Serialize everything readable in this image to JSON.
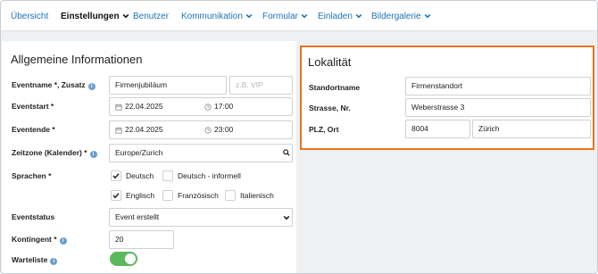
{
  "nav": {
    "items": [
      {
        "label": "Übersicht",
        "dropdown": false,
        "active": false
      },
      {
        "label": "Einstellungen",
        "dropdown": true,
        "active": true
      },
      {
        "label": "Benutzer",
        "dropdown": false,
        "active": false
      },
      {
        "label": "Kommunikation",
        "dropdown": true,
        "active": false
      },
      {
        "label": "Formular",
        "dropdown": true,
        "active": false
      },
      {
        "label": "Einladen",
        "dropdown": true,
        "active": false
      },
      {
        "label": "Bildergalerie",
        "dropdown": true,
        "active": false
      }
    ]
  },
  "general": {
    "title": "Allgemeine Informationen",
    "eventname_label": "Eventname *, Zusatz",
    "eventname_value": "Firmenjubiläum",
    "zusatz_placeholder": "z.B. VIP",
    "start_label": "Eventstart *",
    "start_date": "22.04.2025",
    "start_time": "17:00",
    "end_label": "Eventende *",
    "end_date": "22.04.2025",
    "end_time": "23:00",
    "timezone_label": "Zeitzone (Kalender) *",
    "timezone_value": "Europe/Zurich",
    "languages_label": "Sprachen *",
    "languages": [
      {
        "label": "Deutsch",
        "checked": true
      },
      {
        "label": "Deutsch - informell",
        "checked": false
      },
      {
        "label": "Englisch",
        "checked": true
      },
      {
        "label": "Französisch",
        "checked": false
      },
      {
        "label": "Italienisch",
        "checked": false
      }
    ],
    "status_label": "Eventstatus",
    "status_value": "Event erstellt",
    "quota_label": "Kontingent *",
    "quota_value": "20",
    "waitlist_label": "Warteliste",
    "waitlist_on": true
  },
  "location": {
    "title": "Lokalität",
    "site_label": "Standortname",
    "site_value": "Firmenstandort",
    "street_label": "Strasse, Nr.",
    "street_value": "Weberstrasse 3",
    "city_label": "PLZ, Ort",
    "zip_value": "8004",
    "city_value": "Zürich"
  },
  "colors": {
    "accent": "#1c74b9",
    "highlight_border": "#e8741d",
    "toggle_on": "#5cb85c",
    "info_icon": "#6a9fd0"
  }
}
